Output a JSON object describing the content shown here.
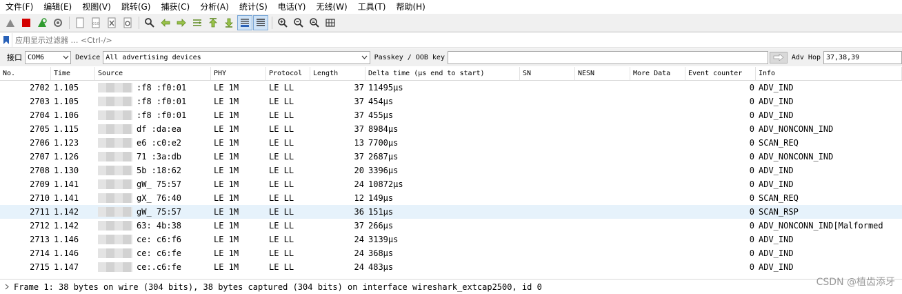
{
  "menu": [
    "文件(F)",
    "编辑(E)",
    "视图(V)",
    "跳转(G)",
    "捕获(C)",
    "分析(A)",
    "统计(S)",
    "电话(Y)",
    "无线(W)",
    "工具(T)",
    "帮助(H)"
  ],
  "toolbar_icons": [
    "shark-fin-start-icon",
    "stop-capture-icon",
    "restart-capture-icon",
    "capture-options-icon",
    "open-file-icon",
    "save-file-icon",
    "close-file-icon",
    "reload-file-icon",
    "find-packet-icon",
    "go-back-icon",
    "go-forward-icon",
    "go-to-packet-icon",
    "go-first-icon",
    "go-last-icon",
    "autoscroll-icon",
    "colorize-icon",
    "zoom-in-icon",
    "zoom-out-icon",
    "zoom-normal-icon",
    "resize-columns-icon"
  ],
  "filter": {
    "placeholder": "应用显示过滤器 … <Ctrl-/>"
  },
  "device_bar": {
    "interface_label": "接口",
    "interface_value": "COM6",
    "device_label": "Device",
    "device_value": "All advertising devices",
    "passkey_label": "Passkey / OOB key",
    "passkey_value": "",
    "advhop_label": "Adv Hop",
    "advhop_value": "37,38,39"
  },
  "columns": [
    "No.",
    "Time",
    "Source",
    "PHY",
    "Protocol",
    "Length",
    "Delta time (µs end to start)",
    "SN",
    "NESN",
    "More Data",
    "Event counter",
    "Info"
  ],
  "packets": [
    {
      "no": "2702",
      "time": "1.105",
      "source": ":f8  :f0:01",
      "phy": "LE 1M",
      "protocol": "LE LL",
      "length": "37",
      "delta": "11495µs",
      "event": "0",
      "info": "ADV_IND"
    },
    {
      "no": "2703",
      "time": "1.105",
      "source": ":f8  :f0:01",
      "phy": "LE 1M",
      "protocol": "LE LL",
      "length": "37",
      "delta": "454µs",
      "event": "0",
      "info": "ADV_IND"
    },
    {
      "no": "2704",
      "time": "1.106",
      "source": ":f8  :f0:01",
      "phy": "LE 1M",
      "protocol": "LE LL",
      "length": "37",
      "delta": "455µs",
      "event": "0",
      "info": "ADV_IND"
    },
    {
      "no": "2705",
      "time": "1.115",
      "source": "df  :da:ea",
      "phy": "LE 1M",
      "protocol": "LE LL",
      "length": "37",
      "delta": "8984µs",
      "event": "0",
      "info": "ADV_NONCONN_IND"
    },
    {
      "no": "2706",
      "time": "1.123",
      "source": "e6  :c0:e2",
      "phy": "LE 1M",
      "protocol": "LE LL",
      "length": "13",
      "delta": "7700µs",
      "event": "0",
      "info": "SCAN_REQ"
    },
    {
      "no": "2707",
      "time": "1.126",
      "source": "71  :3a:db",
      "phy": "LE 1M",
      "protocol": "LE LL",
      "length": "37",
      "delta": "2687µs",
      "event": "0",
      "info": "ADV_NONCONN_IND"
    },
    {
      "no": "2708",
      "time": "1.130",
      "source": "5b  :18:62",
      "phy": "LE 1M",
      "protocol": "LE LL",
      "length": "20",
      "delta": "3396µs",
      "event": "0",
      "info": "ADV_IND"
    },
    {
      "no": "2709",
      "time": "1.141",
      "source": "gW_  75:57",
      "phy": "LE 1M",
      "protocol": "LE LL",
      "length": "24",
      "delta": "10872µs",
      "event": "0",
      "info": "ADV_IND"
    },
    {
      "no": "2710",
      "time": "1.141",
      "source": "gX_  76:40",
      "phy": "LE 1M",
      "protocol": "LE LL",
      "length": "12",
      "delta": "149µs",
      "event": "0",
      "info": "SCAN_REQ"
    },
    {
      "no": "2711",
      "time": "1.142",
      "source": "gW_  75:57",
      "phy": "LE 1M",
      "protocol": "LE LL",
      "length": "36",
      "delta": "151µs",
      "event": "0",
      "info": "SCAN_RSP"
    },
    {
      "no": "2712",
      "time": "1.142",
      "source": "63:  4b:38",
      "phy": "LE 1M",
      "protocol": "LE LL",
      "length": "37",
      "delta": "266µs",
      "event": "0",
      "info": "ADV_NONCONN_IND[Malformed"
    },
    {
      "no": "2713",
      "time": "1.146",
      "source": "ce:  c6:f6",
      "phy": "LE 1M",
      "protocol": "LE LL",
      "length": "24",
      "delta": "3139µs",
      "event": "0",
      "info": "ADV_IND"
    },
    {
      "no": "2714",
      "time": "1.146",
      "source": "ce:  c6:fe",
      "phy": "LE 1M",
      "protocol": "LE LL",
      "length": "24",
      "delta": "368µs",
      "event": "0",
      "info": "ADV_IND"
    },
    {
      "no": "2715",
      "time": "1.147",
      "source": "ce:.c6:fe",
      "phy": "LE 1M",
      "protocol": "LE LL",
      "length": "24",
      "delta": "483µs",
      "event": "0",
      "info": "ADV_IND"
    }
  ],
  "detail": {
    "frame_summary": "Frame 1: 38 bytes on wire (304 bits), 38 bytes captured (304 bits) on interface wireshark_extcap2500, id 0"
  },
  "watermark": "CSDN @植齿添牙",
  "colors": {
    "selected_row": "#e6f2fb",
    "stop_red": "#d40000",
    "start_green": "#2f9b2f"
  }
}
